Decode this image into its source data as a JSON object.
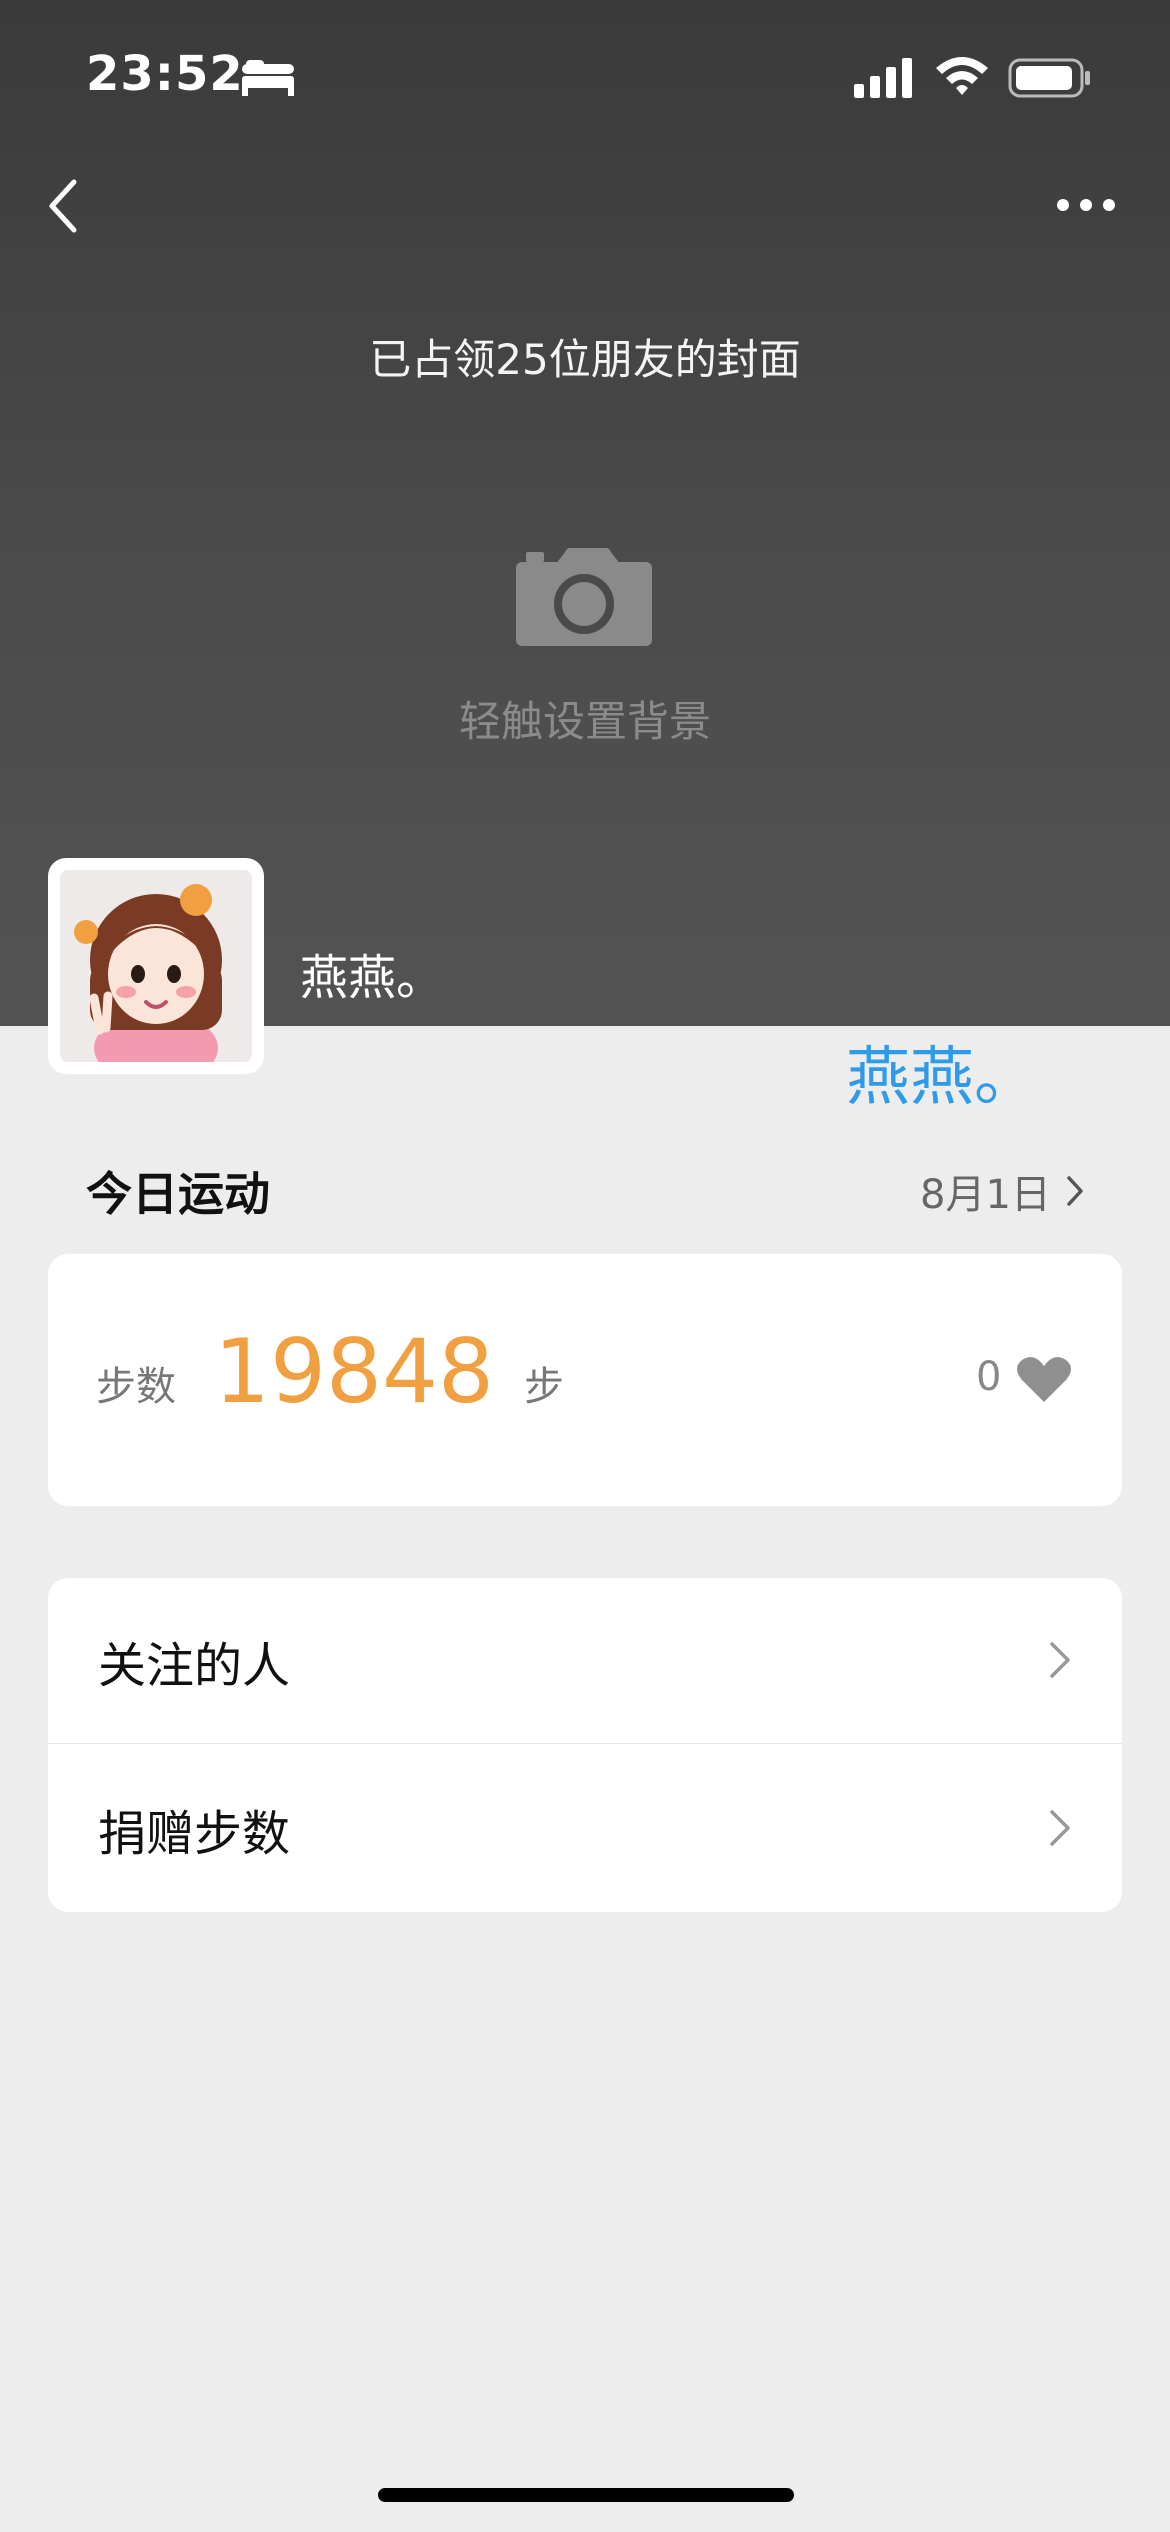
{
  "status_bar": {
    "time": "23:52"
  },
  "cover": {
    "caption": "已占领25位朋友的封面",
    "set_background": "轻触设置背景"
  },
  "profile": {
    "nickname": "燕燕。",
    "nickname_overlay": "燕燕。"
  },
  "today": {
    "title": "今日运动",
    "date": "8月1日",
    "steps_label": "步数",
    "steps": "19848",
    "steps_unit": "步",
    "likes": "0"
  },
  "menu": [
    {
      "label": "关注的人"
    },
    {
      "label": "捐赠步数"
    }
  ],
  "icons": [
    "bed-icon",
    "signal-icon",
    "wifi-icon",
    "battery-icon",
    "back-icon",
    "more-icon",
    "camera-icon",
    "heart-icon",
    "chevron-right-icon"
  ],
  "colors": {
    "accent": "#f0a040",
    "overlay_text": "#2f9be8",
    "cover_bg": "#474747",
    "page_bg": "#ededed"
  }
}
